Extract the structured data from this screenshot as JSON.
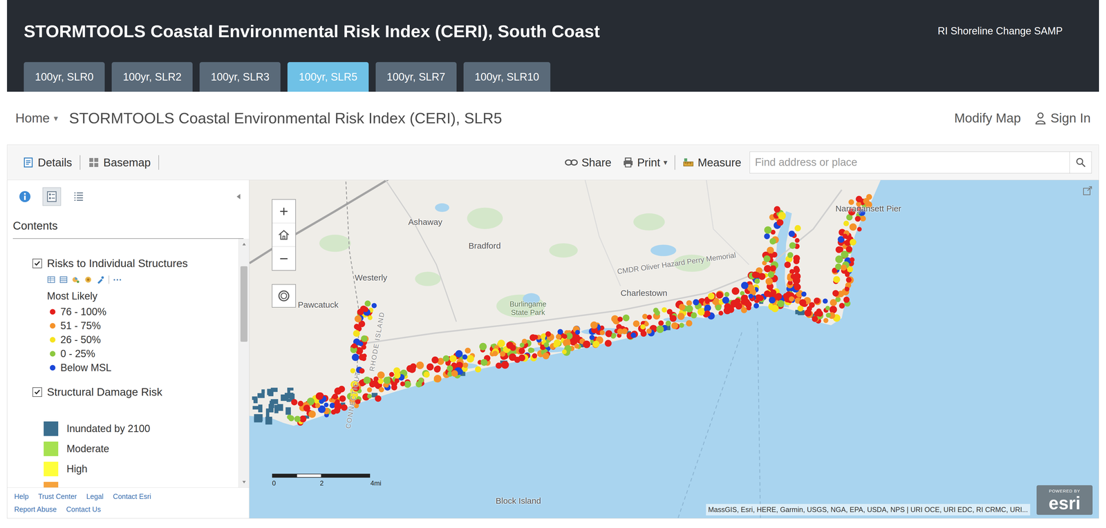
{
  "header": {
    "title": "STORMTOOLS Coastal Environmental Risk Index (CERI), South Coast",
    "subtitle": "RI Shoreline Change SAMP"
  },
  "tabs": [
    {
      "label": "100yr, SLR0",
      "selected": false
    },
    {
      "label": "100yr, SLR2",
      "selected": false
    },
    {
      "label": "100yr, SLR3",
      "selected": false
    },
    {
      "label": "100yr, SLR5",
      "selected": true
    },
    {
      "label": "100yr, SLR7",
      "selected": false
    },
    {
      "label": "100yr, SLR10",
      "selected": false
    }
  ],
  "nav": {
    "home": "Home",
    "caret": "▾",
    "title": "STORMTOOLS Coastal Environmental Risk Index (CERI), SLR5",
    "modify": "Modify Map",
    "sign_in": "Sign In"
  },
  "toolbar": {
    "details": "Details",
    "basemap": "Basemap",
    "share": "Share",
    "print": "Print",
    "print_caret": "▾",
    "measure": "Measure",
    "search": {
      "placeholder": "Find address or place"
    }
  },
  "sidebar": {
    "panels": [
      {
        "selected": false
      },
      {
        "selected": true
      },
      {
        "selected": false
      }
    ],
    "heading": "Contents",
    "layers": [
      {
        "title": "Risks to Individual Structures",
        "checked": true,
        "tools_more": "···",
        "subtitle": "Most Likely",
        "kind": "dot",
        "items": [
          {
            "label": "76 - 100%",
            "color": "#e41f1c"
          },
          {
            "label": "51 - 75%",
            "color": "#f5922a"
          },
          {
            "label": "26 - 50%",
            "color": "#f6e31e"
          },
          {
            "label": "0 - 25%",
            "color": "#8cc83f"
          },
          {
            "label": "Below MSL",
            "color": "#1b47d8"
          }
        ]
      },
      {
        "title": "Structural Damage Risk",
        "checked": true,
        "kind": "swatch",
        "items": [
          {
            "label": "Inundated by 2100",
            "color": "#3a6e8e"
          },
          {
            "label": "Moderate",
            "color": "#a6e150"
          },
          {
            "label": "High",
            "color": "#ffff3a"
          },
          {
            "label": "",
            "color": "#f6a33c"
          }
        ]
      }
    ],
    "footer": [
      [
        "Help",
        "Trust Center",
        "Legal",
        "Contact Esri"
      ],
      [
        "Report Abuse",
        "Contact Us"
      ]
    ]
  },
  "map": {
    "zoom_in": "+",
    "zoom_out": "−",
    "labels": [
      {
        "text": "Ashaway",
        "kind": "place"
      },
      {
        "text": "Bradford",
        "kind": "place"
      },
      {
        "text": "Westerly",
        "kind": "place"
      },
      {
        "text": "Pawcatuck",
        "kind": "place"
      },
      {
        "text": "Burlingame State Park",
        "kind": "park"
      },
      {
        "text": "Charlestown",
        "kind": "place"
      },
      {
        "text": "Narragansett Pier",
        "kind": "place"
      },
      {
        "text": "Block Island",
        "kind": "place"
      },
      {
        "text": "CMDR Oliver Hazard Perry Memorial",
        "kind": "road"
      },
      {
        "text": "CONNECTICUT",
        "kind": "state"
      },
      {
        "text": "RHODE ISLAND",
        "kind": "state"
      }
    ],
    "scale": [
      "0",
      "2",
      "4mi"
    ],
    "attribution": "MassGIS, Esri, HERE, Garmin, USGS, NGA, EPA, USDA, NPS | URI OCE, URI EDC, RI CRMC, URI...",
    "logo": {
      "tagline": "POWERED BY",
      "name": "esri"
    }
  }
}
